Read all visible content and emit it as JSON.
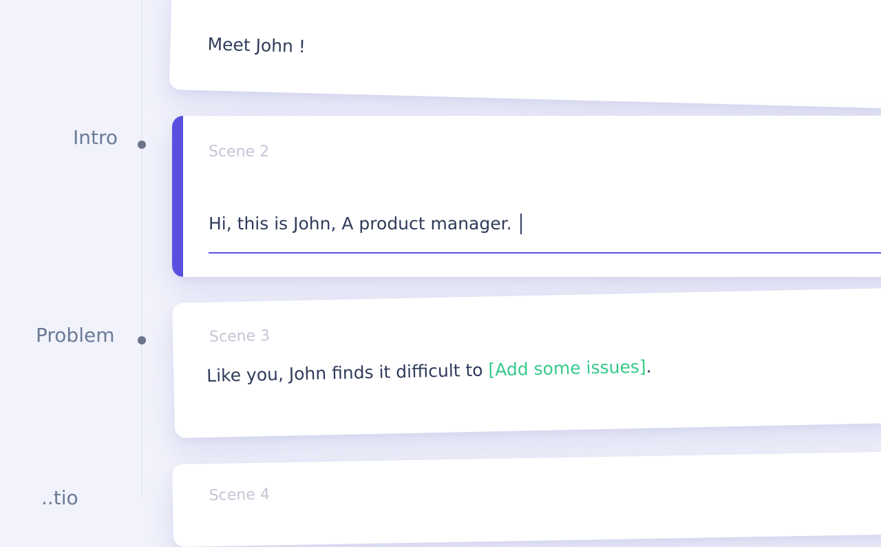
{
  "timeline": {
    "sections": [
      {
        "label": "Intro"
      },
      {
        "label": "Problem"
      },
      {
        "label": "..tio"
      }
    ]
  },
  "scenes": [
    {
      "title": "",
      "text": "Meet John !"
    },
    {
      "title": "Scene 2",
      "value": "Hi, this is John, A product manager.",
      "active": true
    },
    {
      "title": "Scene 3",
      "text_before": "Like you, John finds it difficult to",
      "placeholder": "[Add some issues]",
      "text_after": "."
    },
    {
      "title": "Scene 4"
    }
  ],
  "colors": {
    "accent": "#5a50e0",
    "placeholder_green": "#35c98a",
    "label": "#6a7a94",
    "text": "#2f3b5a"
  }
}
